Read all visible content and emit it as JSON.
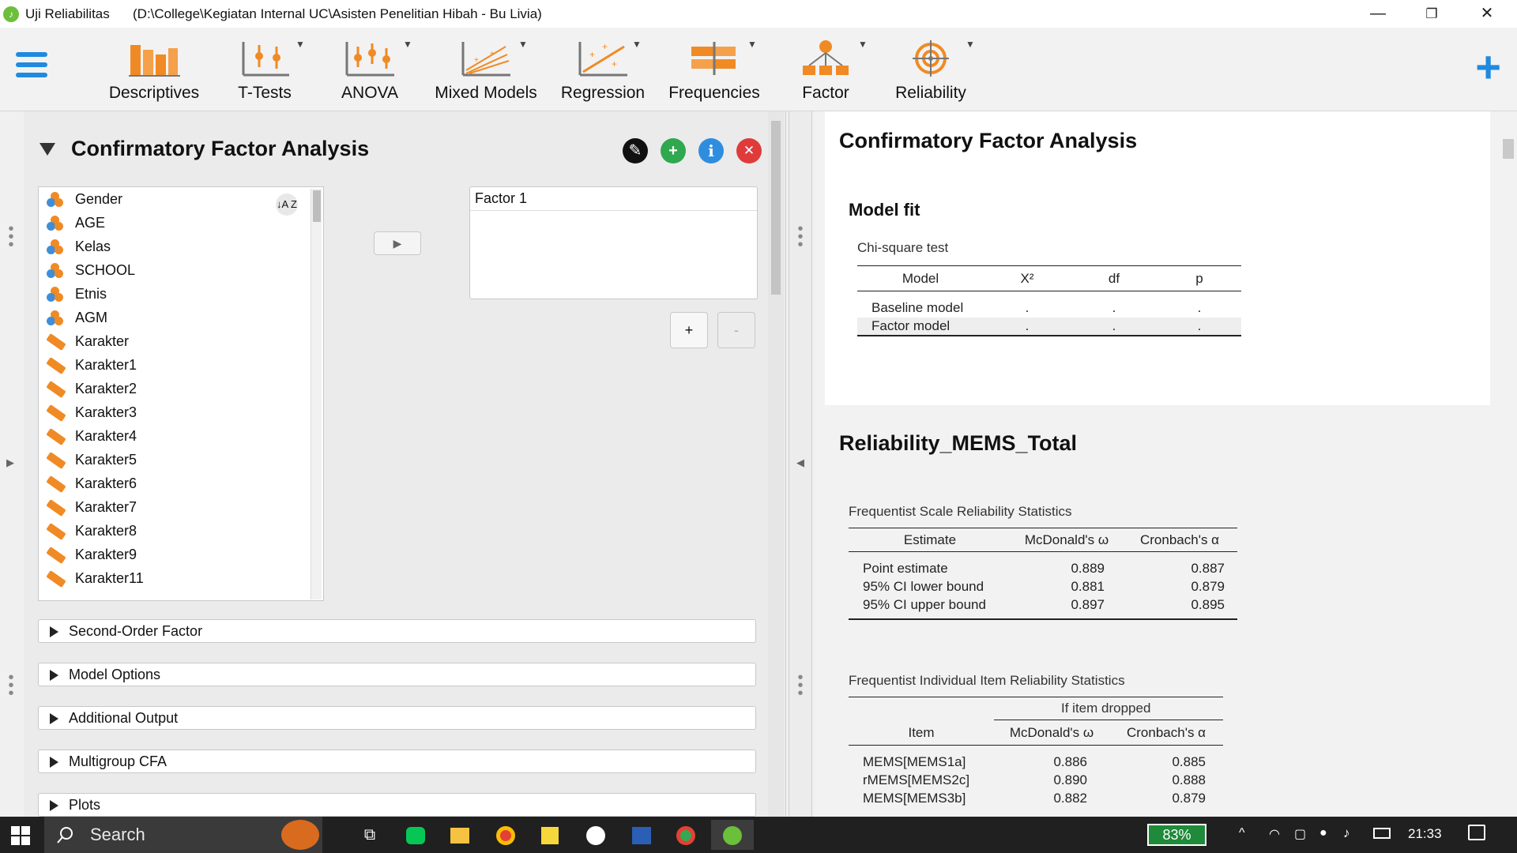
{
  "window": {
    "app_name": "Uji Reliabilitas",
    "path": "(D:\\College\\Kegiatan Internal UC\\Asisten Penelitian Hibah - Bu Livia)",
    "minimize": "—",
    "restore": "❐",
    "close": "✕"
  },
  "ribbon": {
    "items": [
      {
        "label": "Descriptives"
      },
      {
        "label": "T-Tests"
      },
      {
        "label": "ANOVA"
      },
      {
        "label": "Mixed Models"
      },
      {
        "label": "Regression"
      },
      {
        "label": "Frequencies"
      },
      {
        "label": "Factor"
      },
      {
        "label": "Reliability"
      }
    ],
    "add_label": "+"
  },
  "analysis_panel": {
    "title": "Confirmatory Factor Analysis",
    "variables": [
      {
        "name": "Gender",
        "type": "nominal"
      },
      {
        "name": "AGE",
        "type": "nominal"
      },
      {
        "name": "Kelas",
        "type": "nominal"
      },
      {
        "name": "SCHOOL",
        "type": "nominal"
      },
      {
        "name": "Etnis",
        "type": "nominal"
      },
      {
        "name": "AGM",
        "type": "nominal"
      },
      {
        "name": "Karakter",
        "type": "scale"
      },
      {
        "name": "Karakter1",
        "type": "scale"
      },
      {
        "name": "Karakter2",
        "type": "scale"
      },
      {
        "name": "Karakter3",
        "type": "scale"
      },
      {
        "name": "Karakter4",
        "type": "scale"
      },
      {
        "name": "Karakter5",
        "type": "scale"
      },
      {
        "name": "Karakter6",
        "type": "scale"
      },
      {
        "name": "Karakter7",
        "type": "scale"
      },
      {
        "name": "Karakter8",
        "type": "scale"
      },
      {
        "name": "Karakter9",
        "type": "scale"
      },
      {
        "name": "Karakter11",
        "type": "scale"
      }
    ],
    "sort_label": "↓A Z",
    "factor_name": "Factor 1",
    "add_factor": "+",
    "remove_factor": "-",
    "sections": [
      {
        "label": "Second-Order Factor"
      },
      {
        "label": "Model Options"
      },
      {
        "label": "Additional Output"
      },
      {
        "label": "Multigroup CFA"
      },
      {
        "label": "Plots"
      }
    ]
  },
  "results": {
    "cfa_title": "Confirmatory Factor Analysis",
    "model_fit_title": "Model fit",
    "chi_caption": "Chi-square test",
    "chi_headers": [
      "Model",
      "X²",
      "df",
      "p"
    ],
    "chi_rows": [
      {
        "model": "Baseline model",
        "x2": ".",
        "df": ".",
        "p": "."
      },
      {
        "model": "Factor model",
        "x2": ".",
        "df": ".",
        "p": "."
      }
    ],
    "rel_title": "Reliability_MEMS_Total",
    "scale_caption": "Frequentist Scale Reliability Statistics",
    "scale_headers": [
      "Estimate",
      "McDonald's ω",
      "Cronbach's α"
    ],
    "scale_rows": [
      {
        "est": "Point estimate",
        "omega": "0.889",
        "alpha": "0.887"
      },
      {
        "est": "95% CI lower bound",
        "omega": "0.881",
        "alpha": "0.879"
      },
      {
        "est": "95% CI upper bound",
        "omega": "0.897",
        "alpha": "0.895"
      }
    ],
    "item_caption": "Frequentist Individual Item Reliability Statistics",
    "item_group_header": "If item dropped",
    "item_headers": [
      "Item",
      "McDonald's ω",
      "Cronbach's α"
    ],
    "item_rows": [
      {
        "item": "MEMS[MEMS1a]",
        "omega": "0.886",
        "alpha": "0.885"
      },
      {
        "item": "rMEMS[MEMS2c]",
        "omega": "0.890",
        "alpha": "0.888"
      },
      {
        "item": "MEMS[MEMS3b]",
        "omega": "0.882",
        "alpha": "0.879"
      }
    ]
  },
  "taskbar": {
    "search_label": "Search",
    "battery": "83%",
    "time": "21:33"
  },
  "colors": {
    "accent_blue": "#1f8ae0",
    "ribbon_orange": "#f08a24",
    "jasp_green": "#6cbf3a"
  }
}
